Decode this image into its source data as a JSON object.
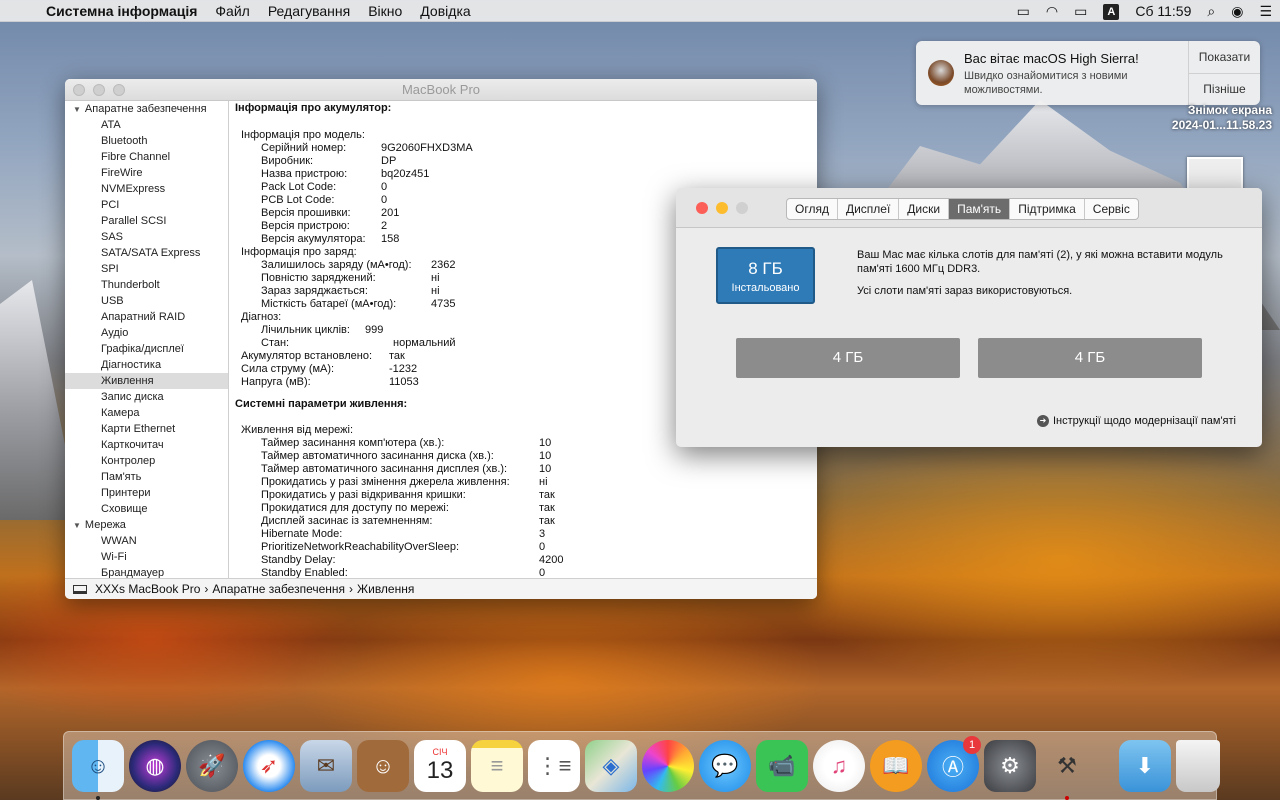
{
  "menubar": {
    "app_name": "Системна інформація",
    "items": [
      "Файл",
      "Редагування",
      "Вікно",
      "Довідка"
    ],
    "input_source": "A",
    "clock": "Сб 11:59"
  },
  "notification": {
    "title": "Вас вітає macOS High Sierra!",
    "subtitle": "Швидко ознайомитися з новими можливостями.",
    "show_label": "Показати",
    "later_label": "Пізніше"
  },
  "screenshot": {
    "label_line1": "Знімок екрана",
    "label_line2": "2024-01...11.58.23"
  },
  "sysinfo": {
    "window_title": "MacBook Pro",
    "sidebar": [
      {
        "label": "Апаратне забезпечення",
        "group": true
      },
      {
        "label": "ATA"
      },
      {
        "label": "Bluetooth"
      },
      {
        "label": "Fibre Channel"
      },
      {
        "label": "FireWire"
      },
      {
        "label": "NVMExpress"
      },
      {
        "label": "PCI"
      },
      {
        "label": "Parallel SCSI"
      },
      {
        "label": "SAS"
      },
      {
        "label": "SATA/SATA Express"
      },
      {
        "label": "SPI"
      },
      {
        "label": "Thunderbolt"
      },
      {
        "label": "USB"
      },
      {
        "label": "Апаратний RAID"
      },
      {
        "label": "Аудіо"
      },
      {
        "label": "Графіка/дисплеї"
      },
      {
        "label": "Діагностика"
      },
      {
        "label": "Живлення",
        "selected": true
      },
      {
        "label": "Запис диска"
      },
      {
        "label": "Камера"
      },
      {
        "label": "Карти Ethernet"
      },
      {
        "label": "Карткочитач"
      },
      {
        "label": "Контролер"
      },
      {
        "label": "Пам'ять"
      },
      {
        "label": "Принтери"
      },
      {
        "label": "Сховище"
      },
      {
        "label": "Мережа",
        "group": true
      },
      {
        "label": "WWAN"
      },
      {
        "label": "Wi-Fi"
      },
      {
        "label": "Брандмауер"
      }
    ],
    "battery_heading": "Інформація про акумулятор:",
    "battery_rows": [
      {
        "key": "Інформація про модель:",
        "value": "",
        "indent": 1
      },
      {
        "key": "Серійний номер:",
        "value": "9G2060FHXD3MA",
        "indent": 2
      },
      {
        "key": "Виробник:",
        "value": "DP",
        "indent": 2
      },
      {
        "key": "Назва пристрою:",
        "value": "bq20z451",
        "indent": 2
      },
      {
        "key": "Pack Lot Code:",
        "value": "0",
        "indent": 2
      },
      {
        "key": "PCB Lot Code:",
        "value": "0",
        "indent": 2
      },
      {
        "key": "Версія прошивки:",
        "value": "201",
        "indent": 2
      },
      {
        "key": "Версія пристрою:",
        "value": "2",
        "indent": 2
      },
      {
        "key": "Версія акумулятора:",
        "value": "158",
        "indent": 2
      },
      {
        "key": "Інформація про заряд:",
        "value": "",
        "indent": 1
      },
      {
        "key": "Залишилось заряду (мА•год):",
        "value": "2362",
        "indent": 3
      },
      {
        "key": "Повністю заряджений:",
        "value": "ні",
        "indent": 3
      },
      {
        "key": "Зараз заряджається:",
        "value": "ні",
        "indent": 3
      },
      {
        "key": "Місткість батареї (мА•год):",
        "value": "4735",
        "indent": 3
      },
      {
        "key": "Діагноз:",
        "value": "",
        "indent": 1
      },
      {
        "key": "Лічильник циклів:",
        "value": "999",
        "indent": 4
      },
      {
        "key": "Стан:",
        "value": "нормальний",
        "indent": 5
      },
      {
        "key": "Акумулятор встановлено:",
        "value": "так",
        "indent": 6
      },
      {
        "key": "Сила струму (мА):",
        "value": "-1232",
        "indent": 7
      },
      {
        "key": "Напруга (мВ):",
        "value": "11053",
        "indent": 7
      }
    ],
    "power_heading": "Системні параметри живлення:",
    "power_rows": [
      {
        "key": "Живлення від мережі:",
        "value": "",
        "indent": 1
      },
      {
        "key": "Таймер засинання комп'ютера (хв.):",
        "value": "10",
        "indent": 8
      },
      {
        "key": "Таймер автоматичного засинання диска (хв.):",
        "value": "10",
        "indent": 8
      },
      {
        "key": "Таймер автоматичного засинання дисплея (хв.):",
        "value": "10",
        "indent": 8
      },
      {
        "key": "Прокидатись у разі змінення джерела живлення:",
        "value": "ні",
        "indent": 8
      },
      {
        "key": "Прокидатись у разі відкривання кришки:",
        "value": "так",
        "indent": 8
      },
      {
        "key": "Прокидатися для доступу по мережі:",
        "value": "так",
        "indent": 8
      },
      {
        "key": "Дисплей засинає із затемненням:",
        "value": "так",
        "indent": 8
      },
      {
        "key": "Hibernate Mode:",
        "value": "3",
        "indent": 8
      },
      {
        "key": "PrioritizeNetworkReachabilityOverSleep:",
        "value": "0",
        "indent": 8
      },
      {
        "key": "Standby Delay:",
        "value": "4200",
        "indent": 8
      },
      {
        "key": "Standby Enabled:",
        "value": "0",
        "indent": 8
      }
    ],
    "pathbar": [
      "XXXs MacBook Pro",
      "Апаратне забезпечення",
      "Живлення"
    ]
  },
  "about": {
    "tabs": [
      "Огляд",
      "Дисплеї",
      "Диски",
      "Пам'ять",
      "Підтримка",
      "Сервіс"
    ],
    "active_tab": "Пам'ять",
    "installed_size": "8 ГБ",
    "installed_label": "Інстальовано",
    "desc1": "Ваш Mac має кілька слотів для пам'яті (2), у які можна вставити модуль пам'яті 1600 МГц DDR3.",
    "desc2": "Усі слоти пам'яті зараз використовуються.",
    "slots": [
      "4 ГБ",
      "4 ГБ"
    ],
    "upgrade_link": "Інструкції щодо модернізації пам'яті"
  },
  "dock": {
    "calendar_month": "СІЧ",
    "calendar_day": "13",
    "app_store_badge": "1",
    "items": [
      "finder-icon",
      "siri-icon",
      "launchpad-icon",
      "safari-icon",
      "mail-icon",
      "contacts-icon",
      "calendar-icon",
      "notes-icon",
      "reminders-icon",
      "maps-icon",
      "photos-icon",
      "messages-icon",
      "facetime-icon",
      "itunes-icon",
      "books-icon",
      "app-store-icon",
      "system-preferences-icon",
      "system-information-icon",
      "downloads-icon",
      "trash-icon"
    ]
  }
}
